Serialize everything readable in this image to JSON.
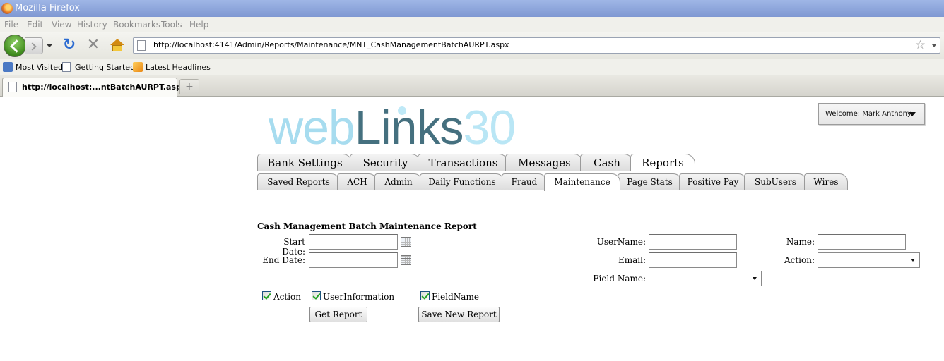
{
  "window": {
    "title": "Mozilla Firefox"
  },
  "menu": [
    "File",
    "Edit",
    "View",
    "History",
    "Bookmarks",
    "Tools",
    "Help"
  ],
  "nav": {
    "url": "http://localhost:4141/Admin/Reports/Maintenance/MNT_CashManagementBatchAURPT.aspx"
  },
  "bookmarks": [
    "Most Visited",
    "Getting Started",
    "Latest Headlines"
  ],
  "browser_tab": {
    "label": "http://localhost:...ntBatchAURPT.aspx",
    "new_tab": "+"
  },
  "logo": {
    "part1": "web",
    "part2": "Links",
    "part3": "30"
  },
  "welcome": {
    "label": "Welcome: Mark Anthony"
  },
  "main_tabs": [
    "Bank Settings",
    "Security",
    "Transactions",
    "Messages",
    "Cash",
    "Reports"
  ],
  "main_tabs_active": "Reports",
  "sub_tabs": [
    "Saved Reports",
    "ACH",
    "Admin",
    "Daily Functions",
    "Fraud",
    "Maintenance",
    "Page Stats",
    "Positive Pay",
    "SubUsers",
    "Wires"
  ],
  "sub_tabs_active": "Maintenance",
  "report": {
    "title": "Cash Management Batch Maintenance Report",
    "start_date_label": "Start Date:",
    "start_date_value": "",
    "end_date_label": "End Date:",
    "end_date_value": "",
    "username_label": "UserName:",
    "username_value": "",
    "email_label": "Email:",
    "email_value": "",
    "fieldname_label": "Field Name:",
    "fieldname_value": "",
    "name_label": "Name:",
    "name_value": "",
    "action_label": "Action:",
    "action_value": "",
    "checkboxes": [
      {
        "label": "Action",
        "checked": true
      },
      {
        "label": "UserInformation",
        "checked": true
      },
      {
        "label": "FieldName",
        "checked": true
      }
    ],
    "get_report_label": "Get Report",
    "save_report_label": "Save New Report"
  }
}
